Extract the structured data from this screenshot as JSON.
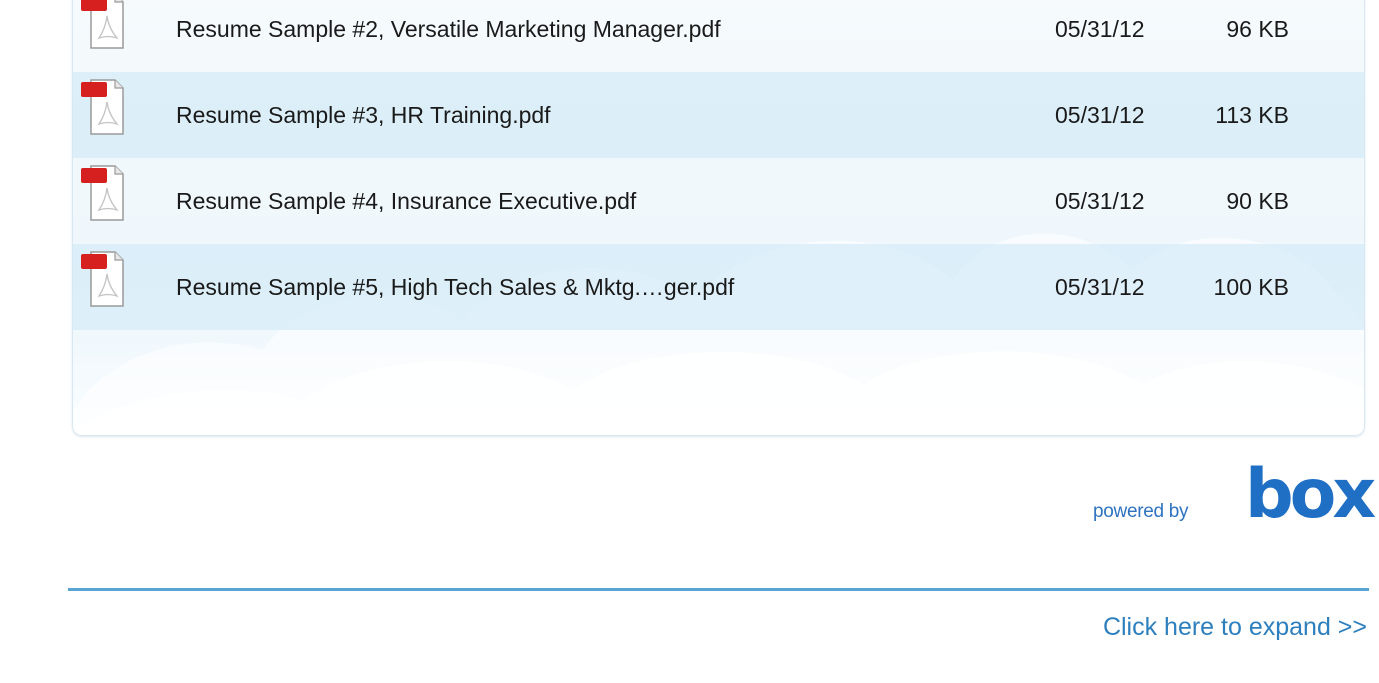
{
  "files": [
    {
      "name": "Resume Sample #2, Versatile Marketing Manager.pdf",
      "date": "05/31/12",
      "size": "96 KB",
      "icon": "pdf-icon",
      "icon_badge": "PDF"
    },
    {
      "name": "Resume Sample #3, HR Training.pdf",
      "date": "05/31/12",
      "size": "113 KB",
      "icon": "pdf-icon",
      "icon_badge": "PDF"
    },
    {
      "name": "Resume Sample #4, Insurance Executive.pdf",
      "date": "05/31/12",
      "size": "90 KB",
      "icon": "pdf-icon",
      "icon_badge": "PDF"
    },
    {
      "name": "Resume Sample #5, High Tech Sales & Mktg.…ger.pdf",
      "date": "05/31/12",
      "size": "100 KB",
      "icon": "pdf-icon",
      "icon_badge": "PDF"
    }
  ],
  "branding": {
    "powered_by": "powered by",
    "logo": "box"
  },
  "footer": {
    "expand_link": "Click here to expand >>"
  },
  "colors": {
    "accent": "#1f6fc5",
    "link": "#2d7fbd",
    "divider": "#5aa4d3",
    "row_highlight": "#d7ecf8",
    "pdf_badge": "#d6201f"
  }
}
